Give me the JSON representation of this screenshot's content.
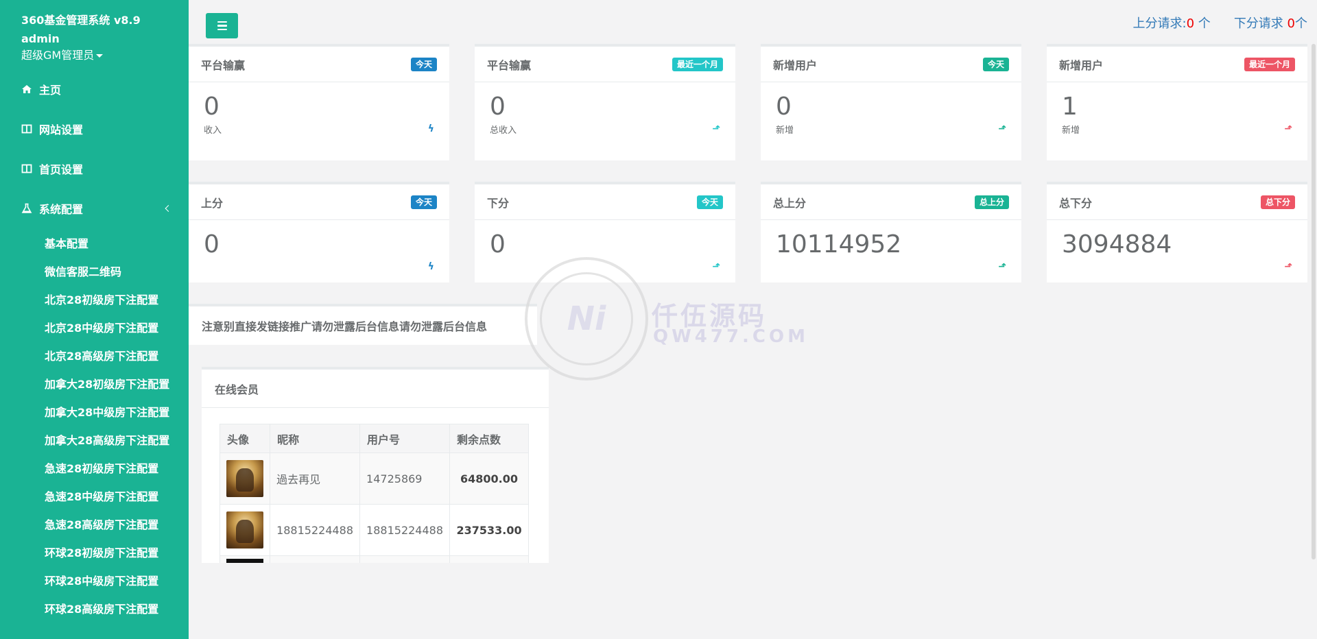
{
  "sidebar": {
    "brand": "360基金管理系统 v8.9",
    "username": "admin",
    "role": "超级GM管理员",
    "nav": [
      {
        "label": "主页",
        "icon": "home-icon"
      },
      {
        "label": "网站设置",
        "icon": "columns-icon"
      },
      {
        "label": "首页设置",
        "icon": "columns-icon"
      },
      {
        "label": "系统配置",
        "icon": "flask-icon"
      }
    ],
    "subitems": [
      "基本配置",
      "微信客服二维码",
      "北京28初级房下注配置",
      "北京28中级房下注配置",
      "北京28高级房下注配置",
      "加拿大28初级房下注配置",
      "加拿大28中级房下注配置",
      "加拿大28高级房下注配置",
      "急速28初级房下注配置",
      "急速28中级房下注配置",
      "急速28高级房下注配置",
      "环球28初级房下注配置",
      "环球28中级房下注配置",
      "环球28高级房下注配置"
    ]
  },
  "topbar": {
    "up_label": "上分请求:",
    "up_count": "0",
    "up_unit": " 个",
    "down_label": "下分请求 ",
    "down_count": "0",
    "down_unit": "个"
  },
  "cards_row1": [
    {
      "title": "平台输赢",
      "badge": "今天",
      "badge_color": "#1c84c6",
      "value": "0",
      "sub": "收入",
      "icon": "bolt-icon"
    },
    {
      "title": "平台输赢",
      "badge": "最近一个月",
      "badge_color": "#23c6c8",
      "value": "0",
      "sub": "总收入",
      "icon": "level-up-icon"
    },
    {
      "title": "新增用户",
      "badge": "今天",
      "badge_color": "#1ab394",
      "value": "0",
      "sub": "新增",
      "icon": "level-up-icon"
    },
    {
      "title": "新增用户",
      "badge": "最近一个月",
      "badge_color": "#ed5565",
      "value": "1",
      "sub": "新增",
      "icon": "level-up-icon"
    }
  ],
  "cards_row2": [
    {
      "title": "上分",
      "badge": "今天",
      "badge_color": "#1c84c6",
      "value": "0",
      "icon": "bolt-icon"
    },
    {
      "title": "下分",
      "badge": "今天",
      "badge_color": "#23c6c8",
      "value": "0",
      "icon": "level-up-icon"
    },
    {
      "title": "总上分",
      "badge": "总上分",
      "badge_color": "#1ab394",
      "value": "10114952",
      "icon": "level-up-icon"
    },
    {
      "title": "总下分",
      "badge": "总下分",
      "badge_color": "#ed5565",
      "value": "3094884",
      "icon": "level-up-icon"
    }
  ],
  "notice": "注意别直接发链接推广请勿泄露后台信息请勿泄露后台信息",
  "online": {
    "title": "在线会员",
    "columns": [
      "头像",
      "昵称",
      "用户号",
      "剩余点数"
    ],
    "rows": [
      {
        "nickname": "過去再见",
        "user_id": "14725869",
        "points": "64800.00"
      },
      {
        "nickname": "18815224488",
        "user_id": "18815224488",
        "points": "237533.00"
      }
    ]
  },
  "watermark": {
    "center": "Ni",
    "name": "仟伍源码",
    "domain": "QW477.COM"
  }
}
